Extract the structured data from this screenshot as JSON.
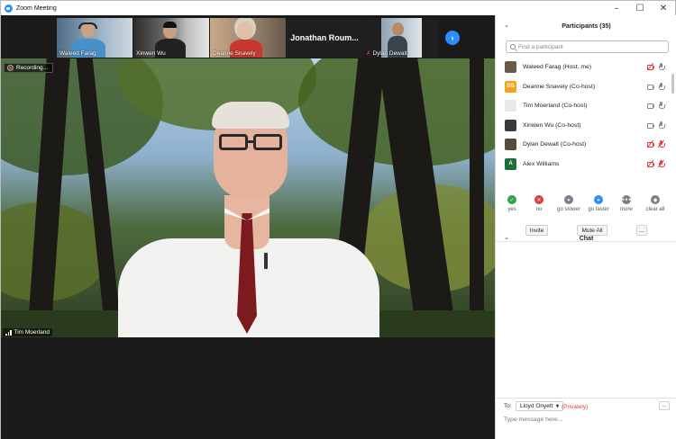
{
  "window": {
    "title": "Zoom Meeting"
  },
  "thumbnails": [
    {
      "name": "Waleed Farag",
      "muted": false
    },
    {
      "name": "Xinwen Wu",
      "muted": false
    },
    {
      "name": "Deanne Snavely",
      "muted": false
    },
    {
      "name": "Jonathan Roum...",
      "muted": false,
      "text_only": true
    },
    {
      "name": "Dylan Dewalt",
      "muted": true
    }
  ],
  "speaker": {
    "name": "Tim Moerland",
    "recording_label": "Recording..."
  },
  "participants": {
    "header": "Participants (35)",
    "search_placeholder": "Find a participant",
    "list": [
      {
        "name": "Waleed Farag (Host, me)",
        "avatar_initials": "",
        "avatar_color": "#6b5a48",
        "cam_off": true,
        "mic_off": false
      },
      {
        "name": "Deanne Snavely (Co-host)",
        "avatar_initials": "DS",
        "avatar_color": "#f6a21a",
        "cam_off": false,
        "mic_off": false
      },
      {
        "name": "Tim Moerland (Co-host)",
        "avatar_initials": "",
        "avatar_color": "#e8e8e8",
        "cam_off": false,
        "mic_off": false
      },
      {
        "name": "Xinwen Wu (Co-host)",
        "avatar_initials": "",
        "avatar_color": "#3a3a3a",
        "cam_off": false,
        "mic_off": false
      },
      {
        "name": "Dylan Dewalt (Co-host)",
        "avatar_initials": "",
        "avatar_color": "#5a4a3a",
        "cam_off": true,
        "mic_off": true
      },
      {
        "name": "Alex Williams",
        "avatar_initials": "A",
        "avatar_color": "#1e6e3a",
        "cam_off": true,
        "mic_off": true
      }
    ],
    "feedback": [
      {
        "label": "yes",
        "symbol": "✓",
        "color": "#2ea44f"
      },
      {
        "label": "no",
        "symbol": "✕",
        "color": "#e0403a"
      },
      {
        "label": "go slower",
        "symbol": "«",
        "color": "#7a7f8a"
      },
      {
        "label": "go faster",
        "symbol": "»",
        "color": "#2d8cff"
      },
      {
        "label": "more",
        "symbol": "•••",
        "color": "#7a7f8a"
      },
      {
        "label": "clear all",
        "symbol": "◆",
        "color": "#7a7f8a"
      }
    ],
    "invite_label": "Invite",
    "mute_all_label": "Mute All",
    "more_label": "..."
  },
  "chat": {
    "header": "Chat",
    "to_label": "To:",
    "recipient": "Lloyd Onyett",
    "privacy": "(Privately)",
    "more_label": "...",
    "input_placeholder": "Type message here..."
  }
}
